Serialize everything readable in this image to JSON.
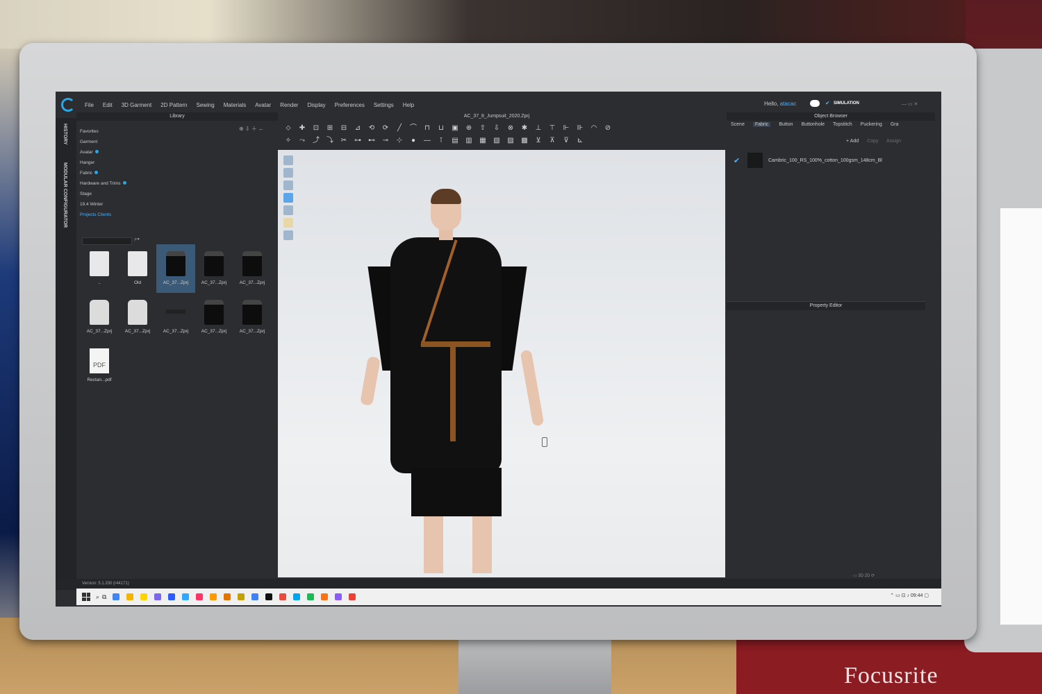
{
  "app": {
    "menu": [
      "File",
      "Edit",
      "3D Garment",
      "2D Pattern",
      "Sewing",
      "Materials",
      "Avatar",
      "Render",
      "Display",
      "Preferences",
      "Settings",
      "Help"
    ],
    "greeting": "Hello,",
    "username": "atacac",
    "mode_label": "SIMULATION",
    "window_controls": "— ▭ ✕"
  },
  "left_tabs": {
    "history": "HISTORY",
    "modular": "MODULAR CONFIGURATOR"
  },
  "library": {
    "title": "Library",
    "tree": [
      {
        "label": "Favorites",
        "dot": false
      },
      {
        "label": "Garment",
        "dot": false
      },
      {
        "label": "Avatar",
        "dot": true
      },
      {
        "label": "Hanger",
        "dot": false
      },
      {
        "label": "Fabric",
        "dot": true
      },
      {
        "label": "Hardware and Trims",
        "dot": true
      },
      {
        "label": "Stage",
        "dot": false
      },
      {
        "label": "19.4 Winter",
        "dot": false
      },
      {
        "label": "Projects Clients",
        "dot": false,
        "active": true
      }
    ],
    "files": [
      {
        "name": "..",
        "kind": "folder"
      },
      {
        "name": "Old",
        "kind": "folder"
      },
      {
        "name": "AC_37...Zprj",
        "kind": "garment",
        "selected": true
      },
      {
        "name": "AC_37...Zprj",
        "kind": "garment"
      },
      {
        "name": "AC_37...Zprj",
        "kind": "garment"
      },
      {
        "name": "AC_37...Zprj",
        "kind": "garment-white"
      },
      {
        "name": "AC_37...Zprj",
        "kind": "garment-white"
      },
      {
        "name": "AC_37...Zprj",
        "kind": "small"
      },
      {
        "name": "AC_37...Zprj",
        "kind": "garment"
      },
      {
        "name": "AC_37...Zprj",
        "kind": "garment"
      },
      {
        "name": "Rectan...pdf",
        "kind": "pdf",
        "badge": "PDF"
      }
    ]
  },
  "document_title": "AC_37_8_Jumpsuit_2020.Zprj",
  "object_browser": {
    "title": "Object Browser",
    "tabs": [
      "Scene",
      "Fabric",
      "Button",
      "Buttonhole",
      "Topstitch",
      "Puckering",
      "Gra"
    ],
    "active_tab": "Fabric",
    "add_label": "+ Add",
    "copy_label": "Copy",
    "assign_label": "Assign",
    "fabric_item": "Cambric_100_RS_100%_cotton_100gsm_148cm_Bl"
  },
  "property_editor": {
    "title": "Property Editor"
  },
  "status": {
    "version": "Version: 5.1.330 (r44171)"
  },
  "taskbar": {
    "clock": "09:44",
    "app_colors": [
      "#4285f4",
      "#f4b400",
      "#ffd400",
      "#7b68ee",
      "#2a5cff",
      "#31a8ff",
      "#ff3366",
      "#ff9a00",
      "#e37400",
      "#c4a000",
      "#3b82f6",
      "#111111",
      "#e84c3d",
      "#00a4ef",
      "#1db954",
      "#f97316",
      "#8b5cf6",
      "#ea4335"
    ]
  },
  "colors": {
    "accent": "#4db3ff",
    "panel": "#2b2d30",
    "viewport": "#e6e9ec"
  }
}
